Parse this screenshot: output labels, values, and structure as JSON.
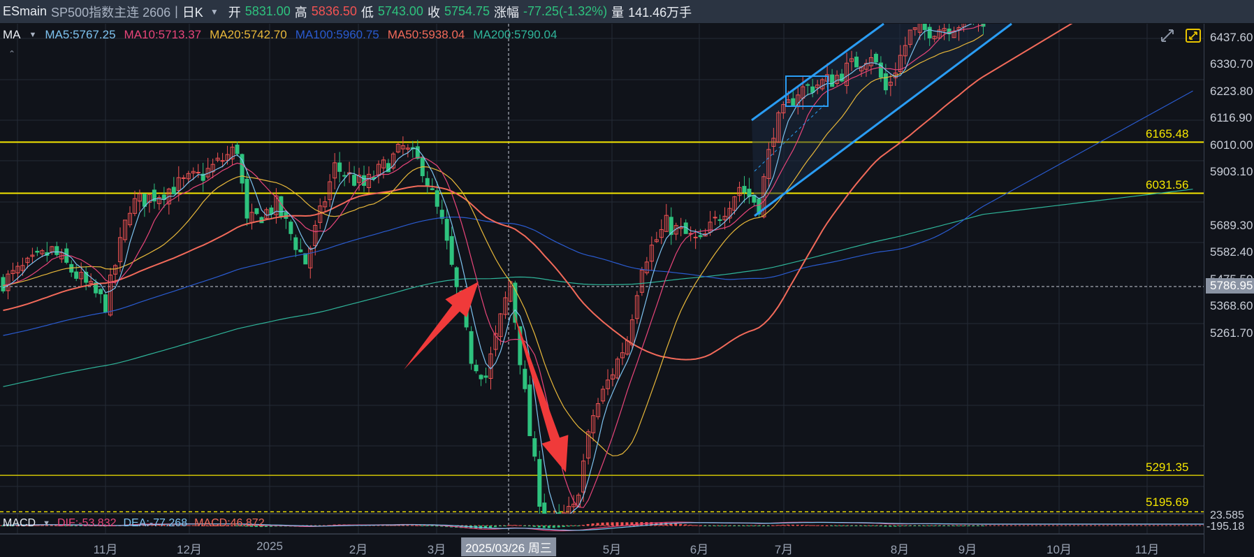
{
  "header": {
    "symbol": "ESmain",
    "name": "SP500指数主连 2606",
    "separator": "|",
    "period": "日K",
    "open_label": "开",
    "open": "5831.00",
    "high_label": "高",
    "high": "5836.50",
    "low_label": "低",
    "low": "5743.00",
    "close_label": "收",
    "close": "5754.75",
    "change_label": "涨幅",
    "change": "-77.25(-1.32%)",
    "volume_label": "量",
    "volume": "141.46万手"
  },
  "ma_legend": {
    "label": "MA",
    "items": [
      {
        "text": "MA5:5767.25",
        "color": "#7ec3f0"
      },
      {
        "text": "MA10:5713.37",
        "color": "#e8457a"
      },
      {
        "text": "MA20:5742.70",
        "color": "#e8b83a"
      },
      {
        "text": "MA100:5960.75",
        "color": "#2a5bd0"
      },
      {
        "text": "MA50:5938.04",
        "color": "#f26a5a"
      },
      {
        "text": "MA200:5790.04",
        "color": "#2fb59a"
      }
    ]
  },
  "macd_legend": {
    "label": "MACD",
    "dif": "DIF:-53.832",
    "dea": "DEA:-77.268",
    "macd": "MACD:46.872"
  },
  "price_axis": [
    "6437.60",
    "6330.70",
    "6223.80",
    "6116.90",
    "6010.00",
    "5903.10",
    "5689.30",
    "5582.40",
    "5475.50",
    "5368.60",
    "5261.70"
  ],
  "current_price": "5786.95",
  "macd_axis": [
    "23.585",
    "-195.18"
  ],
  "horizontal_lines": [
    "6165.48",
    "6031.56",
    "5291.35",
    "5195.69"
  ],
  "x_axis": [
    "11月",
    "12月",
    "2025",
    "2月",
    "3月",
    "5月",
    "6月",
    "7月",
    "8月",
    "9月",
    "10月",
    "11月"
  ],
  "crosshair_date": "2025/03/26 周三",
  "colors": {
    "up": "#f25353",
    "down": "#2ec27e",
    "level": "#f5e600",
    "channel": "#2a9df4",
    "arrow": "#f03a3a"
  },
  "chart_data": {
    "type": "candlestick",
    "anchors": [
      [
        0,
        5800
      ],
      [
        10,
        5880
      ],
      [
        21,
        5740
      ],
      [
        26,
        6000
      ],
      [
        41,
        6080
      ],
      [
        48,
        6150
      ],
      [
        50,
        5950
      ],
      [
        56,
        6000
      ],
      [
        62,
        5850
      ],
      [
        68,
        6100
      ],
      [
        74,
        6050
      ],
      [
        82,
        6150
      ],
      [
        86,
        6100
      ],
      [
        90,
        5950
      ],
      [
        96,
        5600
      ],
      [
        99,
        5550
      ],
      [
        104,
        5800
      ],
      [
        108,
        5400
      ],
      [
        111,
        5150
      ],
      [
        117,
        5200
      ],
      [
        121,
        5450
      ],
      [
        128,
        5650
      ],
      [
        131,
        5850
      ],
      [
        136,
        5950
      ],
      [
        143,
        5900
      ],
      [
        151,
        6050
      ],
      [
        155,
        6000
      ],
      [
        158,
        6200
      ],
      [
        163,
        6300
      ],
      [
        170,
        6330
      ],
      [
        178,
        6400
      ],
      [
        181,
        6300
      ],
      [
        186,
        6450
      ],
      [
        197,
        6480
      ],
      [
        201,
        6490
      ]
    ]
  }
}
